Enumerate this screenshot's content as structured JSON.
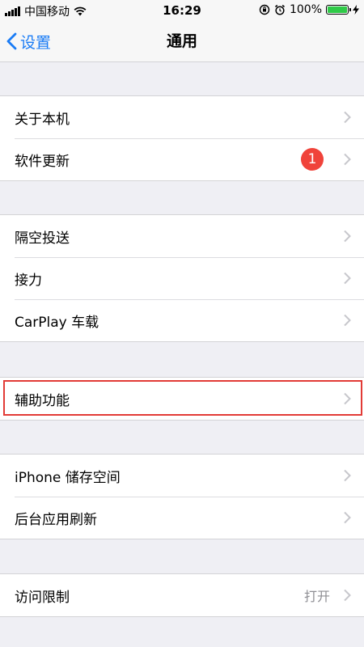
{
  "status_bar": {
    "carrier": "中国移动",
    "time": "16:29",
    "battery": "100%",
    "battery_level": 1.0
  },
  "nav": {
    "back_label": "设置",
    "title": "通用"
  },
  "groups": [
    {
      "items": [
        {
          "label": "关于本机"
        },
        {
          "label": "软件更新",
          "badge": "1"
        }
      ]
    },
    {
      "items": [
        {
          "label": "隔空投送"
        },
        {
          "label": "接力"
        },
        {
          "label": "CarPlay 车载"
        }
      ]
    },
    {
      "items": [
        {
          "label": "辅助功能"
        }
      ]
    },
    {
      "items": [
        {
          "label": "iPhone 储存空间"
        },
        {
          "label": "后台应用刷新"
        }
      ]
    },
    {
      "items": [
        {
          "label": "访问限制",
          "detail": "打开"
        }
      ]
    }
  ],
  "colors": {
    "accent": "#1a7cf5",
    "badge": "#f0433a",
    "highlight": "#e23b36",
    "background": "#efeff4"
  }
}
